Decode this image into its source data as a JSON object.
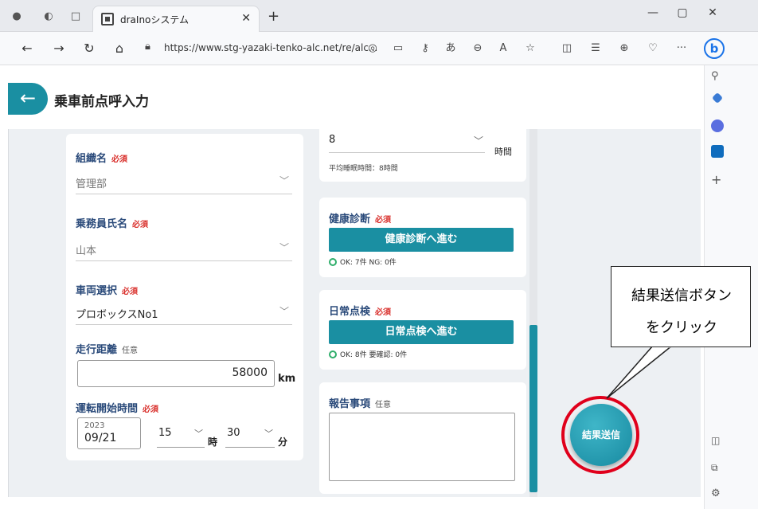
{
  "browser": {
    "tab_title": "draInoシステム",
    "url": "https://www.stg-yazaki-tenko-alc.net/re/alc...",
    "bing_label": "b"
  },
  "page": {
    "title": "乗車前点呼入力"
  },
  "form": {
    "organization": {
      "label": "組織名",
      "required": "必須",
      "value": "管理部"
    },
    "crew": {
      "label": "乗務員氏名",
      "required": "必須",
      "value": "山本"
    },
    "vehicle": {
      "label": "車両選択",
      "required": "必須",
      "value": "プロボックスNo1"
    },
    "distance": {
      "label": "走行距離",
      "optional": "任意",
      "value": "58000",
      "unit": "km"
    },
    "start_time": {
      "label": "運転開始時間",
      "required": "必須",
      "year": "2023",
      "month_day": "09/21",
      "hour": "15",
      "hour_unit": "時",
      "minute": "30",
      "minute_unit": "分"
    },
    "sleep": {
      "value": "8",
      "unit": "時間",
      "average": "平均睡眠時間：8時間"
    },
    "health": {
      "label": "健康診断",
      "required": "必須",
      "button": "健康診断へ進む",
      "status": "OK: 7件 NG: 0件"
    },
    "daily": {
      "label": "日常点検",
      "required": "必須",
      "button": "日常点検へ進む",
      "status": "OK: 8件 要確認: 0件"
    },
    "report": {
      "label": "報告事項",
      "optional": "任意"
    },
    "submit": "結果送信"
  },
  "callout": {
    "line1": "結果送信ボタン",
    "line2": "をクリック"
  },
  "colors": {
    "accent": "#1a8fa2",
    "required": "#d9302c",
    "highlight": "#e0001b"
  }
}
